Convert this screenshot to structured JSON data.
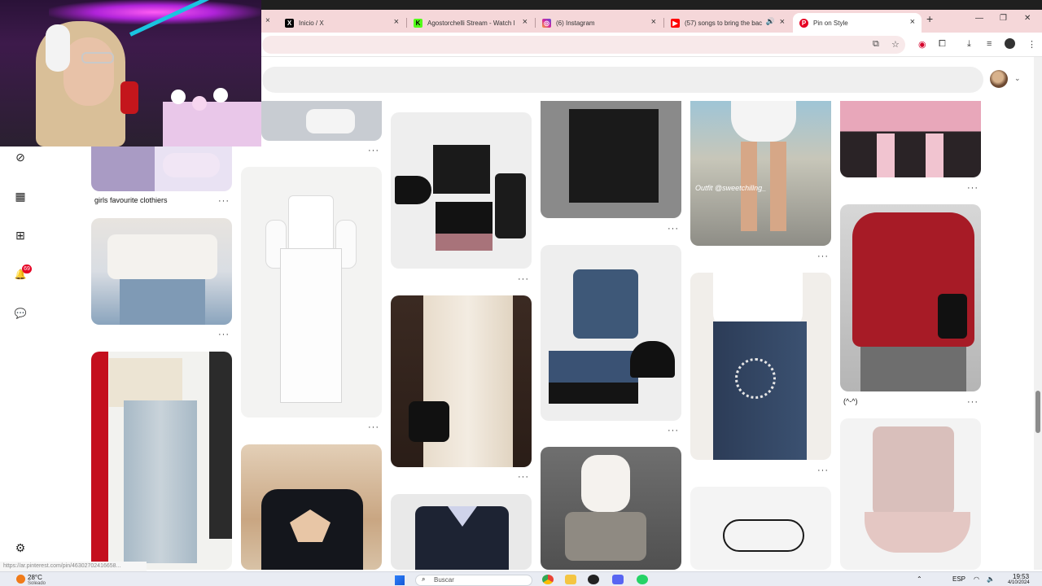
{
  "browser": {
    "tabs": [
      {
        "label": "Inicio / X",
        "icon": "x-logo-icon"
      },
      {
        "label": "Agostorchelli Stream - Watch l",
        "icon": "kick-logo-icon"
      },
      {
        "label": "(6) Instagram",
        "icon": "instagram-logo-icon"
      },
      {
        "label": "(57) songs to bring the bac",
        "icon": "youtube-logo-icon"
      },
      {
        "label": "Pin on Style",
        "icon": "pinterest-logo-icon"
      }
    ],
    "active_tab": "Pin on Style",
    "close_glyph": "×",
    "new_tab_glyph": "+",
    "window_controls": [
      "—",
      "❐",
      "✕"
    ]
  },
  "toolbar_glyphs": {
    "install": "⧉",
    "star": "☆",
    "ext": "◉",
    "puzzle": "⧠",
    "download": "⤓",
    "list": "≡",
    "menu": "⋮"
  },
  "sidebar": {
    "explore_glyph": "⊘",
    "boards_glyph": "▦",
    "create_glyph": "⊞",
    "notifications_glyph": "🔔",
    "notifications_count": "69",
    "messages_glyph": "💬",
    "settings_glyph": "⚙"
  },
  "header": {
    "chevron_glyph": "⌄"
  },
  "pins": {
    "captions": [
      "girls favourite clothiers",
      "(^-^)"
    ],
    "overlay_text": "Outfit @sweetchillng_",
    "dots": "···"
  },
  "status_url": "https://ar.pinterest.com/pin/46302702416658...",
  "taskbar": {
    "weather_temp": "28°C",
    "weather_desc": "Soleado",
    "search_placeholder": "Buscar",
    "language": "ESP",
    "time": "19:53",
    "date": "4/10/2024"
  },
  "colors": {
    "tabbar_bg": "#f5d7d9",
    "pinterest_red": "#e60023",
    "taskbar_bg": "#e9ecf3"
  }
}
